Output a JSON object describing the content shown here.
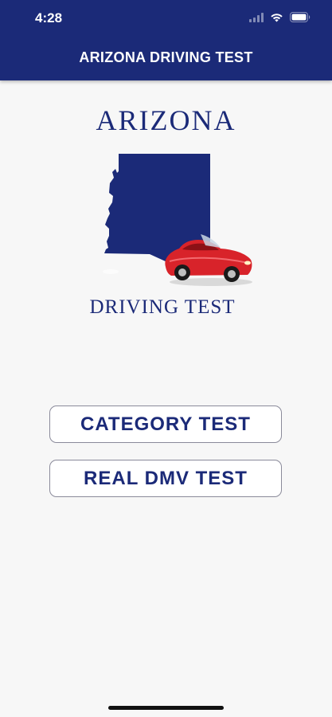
{
  "status_bar": {
    "time": "4:28",
    "icons": [
      "signal-icon",
      "wifi-icon",
      "battery-icon"
    ]
  },
  "nav": {
    "title": "ARIZONA DRIVING TEST"
  },
  "logo": {
    "title": "ARIZONA",
    "subtitle": "DRIVING TEST",
    "graphic": "arizona-map-with-car"
  },
  "buttons": {
    "category_test": "CATEGORY TEST",
    "real_dmv_test": "REAL DMV TEST"
  },
  "colors": {
    "brand_navy": "#1b2a78",
    "background": "#f7f7f7",
    "button_background": "#ffffff",
    "car_red": "#d8232a"
  }
}
